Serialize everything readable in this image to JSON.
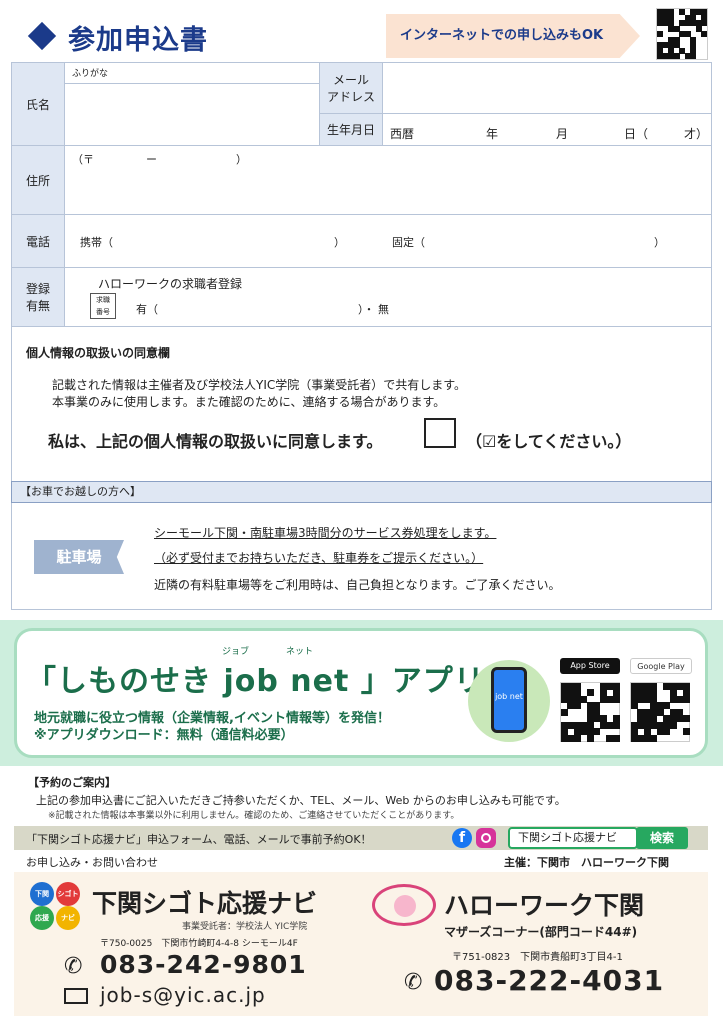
{
  "header": {
    "title": "参加申込書",
    "banner": "インターネットでの申し込みもOK"
  },
  "form": {
    "name_label": "氏名",
    "furigana": "ふりがな",
    "email_label_1": "メール",
    "email_label_2": "アドレス",
    "birth_label": "生年月日",
    "birth_era": "西暦",
    "birth_year": "年",
    "birth_month": "月",
    "birth_day": "日（",
    "birth_age": "才）",
    "address_label": "住所",
    "postal_open": "（〒",
    "postal_dash": "ー",
    "postal_close": "）",
    "phone_label": "電話",
    "mobile": "携帯（",
    "mobile_close": "）",
    "landline": "固定（",
    "landline_close": "）",
    "reg_label_1": "登録",
    "reg_label_2": "有無",
    "reg_title": "ハローワークの求職者登録",
    "reg_badge_1": "求職",
    "reg_badge_2": "番号",
    "reg_yes": "有（",
    "reg_no": "）・ 無"
  },
  "privacy": {
    "title": "個人情報の取扱いの同意欄",
    "line1": "記載された情報は主催者及び学校法人YIC学院（事業受託者）で共有します。",
    "line2": "本事業のみに使用します。また確認のために、連絡する場合があります。",
    "agree": "私は、上記の個人情報の取扱いに同意します。",
    "agree_note": "（☑をしてください。）"
  },
  "car": {
    "header": "【お車でお越しの方へ】",
    "label": "駐車場",
    "line1": "シーモール下関・南駐車場3時間分のサービス券処理をします。",
    "line2": "（必ず受付までお持ちいただき、駐車券をご提示ください。）",
    "line3": "近隣の有料駐車場等をご利用時は、自己負担となります。ご了承ください。"
  },
  "app": {
    "title": "「しものせき job net 」アプリ",
    "ruby_job": "ジョブ",
    "ruby_net": "ネット",
    "line1": "地元就職に役立つ情報（企業情報,イベント情報等）を発信！",
    "line2": "※アプリダウンロード：無料（通信料必要）",
    "app_store": "App Store",
    "google_play": "Google Play",
    "phone_text": "job net"
  },
  "reservation": {
    "title": "【予約のご案内】",
    "line1": "上記の参加申込書にご記入いただきご持参いただくか、TEL、メール、Web からのお申し込みも可能です。",
    "line2": "※記載された情報は本事業以外に利用しません。確認のため、ご連絡させていただくことがあります。",
    "bar_text": "「下関シゴト応援ナビ」申込フォーム、電話、メールで事前予約OK！",
    "search_text": "下関シゴト応援ナビ",
    "search_button": "検索",
    "contact_left": "お申し込み・お問い合わせ",
    "contact_right": "主催：下関市　ハローワーク下関"
  },
  "yic": {
    "name": "下関シゴト応援ナビ",
    "sub": "事業受託者：学校法人 YIC学院",
    "addr": "〒750-0025　下関市竹崎町4-4-8 シーモール4F",
    "tel": "083-242-9801",
    "mail": "job-s@yic.ac.jp",
    "logo_1": "下関",
    "logo_2": "シゴト",
    "logo_3": "応援",
    "logo_4": "ナビ"
  },
  "hw": {
    "name": "ハローワーク下関",
    "sub": "マザーズコーナー(部門コード44#)",
    "addr": "〒751-0823　下関市貴船町3丁目4-1",
    "tel": "083-222-4031"
  },
  "colors": {
    "navy": "#1b3a8a",
    "label_bg": "#dfe7f3",
    "app_green": "#1b6e4b"
  }
}
